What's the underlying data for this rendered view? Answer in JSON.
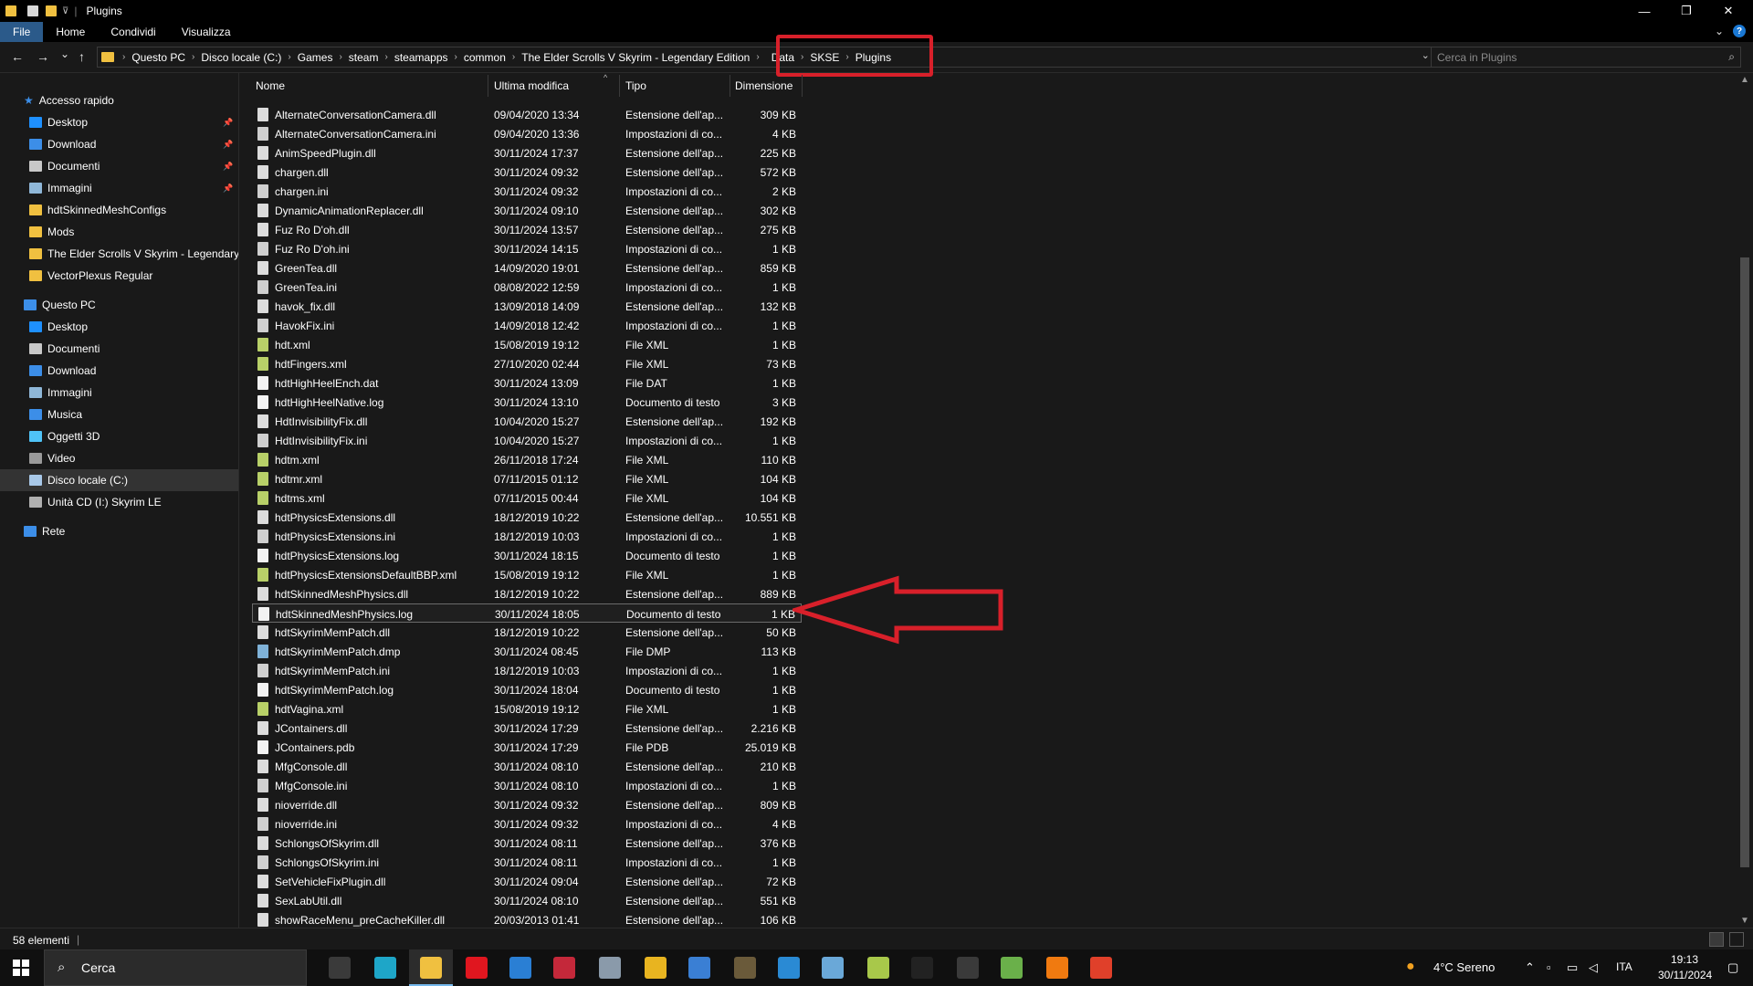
{
  "window": {
    "title": "Plugins",
    "minimize_glyph": "—",
    "maximize_glyph": "❐",
    "close_glyph": "✕"
  },
  "ribbon": {
    "tabs": [
      {
        "label": "File",
        "active": true
      },
      {
        "label": "Home",
        "active": false
      },
      {
        "label": "Condividi",
        "active": false
      },
      {
        "label": "Visualizza",
        "active": false
      }
    ],
    "help": "?"
  },
  "nav": {
    "back": "←",
    "forward": "→",
    "recent": "⌄",
    "up": "↑",
    "breadcrumb": [
      "Questo PC",
      "Disco locale (C:)",
      "Games",
      "steam",
      "steamapps",
      "common",
      "The Elder Scrolls V Skyrim - Legendary Edition",
      "Data",
      "SKSE",
      "Plugins"
    ],
    "dropdown": "⌄",
    "refresh": "↻",
    "search_placeholder": "Cerca in Plugins"
  },
  "sidebar": {
    "quick_access": {
      "label": "Accesso rapido",
      "icon": "star-icon"
    },
    "quick_items": [
      {
        "label": "Desktop",
        "icon": "desktop-icon",
        "pinned": true,
        "color": "#1e90ff"
      },
      {
        "label": "Download",
        "icon": "download-icon",
        "pinned": true,
        "color": "#3c8ee8"
      },
      {
        "label": "Documenti",
        "icon": "document-icon",
        "pinned": true,
        "color": "#c8c8c8"
      },
      {
        "label": "Immagini",
        "icon": "pictures-icon",
        "pinned": true,
        "color": "#8fb7d8"
      },
      {
        "label": "hdtSkinnedMeshConfigs",
        "icon": "folder-icon",
        "pinned": false,
        "color": "#f0c040"
      },
      {
        "label": "Mods",
        "icon": "folder-icon",
        "pinned": false,
        "color": "#f0c040"
      },
      {
        "label": "The Elder Scrolls V Skyrim - Legendary E",
        "icon": "folder-icon",
        "pinned": false,
        "color": "#f0c040"
      },
      {
        "label": "VectorPlexus Regular",
        "icon": "folder-icon",
        "pinned": false,
        "color": "#f0c040"
      }
    ],
    "this_pc": {
      "label": "Questo PC",
      "icon": "computer-icon"
    },
    "pc_items": [
      {
        "label": "Desktop",
        "icon": "desktop-icon",
        "color": "#1e90ff",
        "selected": false
      },
      {
        "label": "Documenti",
        "icon": "document-icon",
        "color": "#c8c8c8",
        "selected": false
      },
      {
        "label": "Download",
        "icon": "download-icon",
        "color": "#3c8ee8",
        "selected": false
      },
      {
        "label": "Immagini",
        "icon": "pictures-icon",
        "color": "#8fb7d8",
        "selected": false
      },
      {
        "label": "Musica",
        "icon": "music-icon",
        "color": "#3c8ee8",
        "selected": false
      },
      {
        "label": "Oggetti 3D",
        "icon": "cube-icon",
        "color": "#4fc3f7",
        "selected": false
      },
      {
        "label": "Video",
        "icon": "video-icon",
        "color": "#9a9a9a",
        "selected": false
      },
      {
        "label": "Disco locale (C:)",
        "icon": "drive-icon",
        "color": "#a8c8e8",
        "selected": true
      },
      {
        "label": "Unità CD (I:) Skyrim LE",
        "icon": "cd-drive-icon",
        "color": "#b0b0b0",
        "selected": false
      }
    ],
    "network": {
      "label": "Rete",
      "icon": "network-icon"
    }
  },
  "columns": {
    "name": "Nome",
    "modified": "Ultima modifica",
    "type": "Tipo",
    "size": "Dimensione",
    "sort_glyph": "^"
  },
  "files": [
    {
      "name": "AlternateConversationCamera.dll",
      "date": "09/04/2020 13:34",
      "type": "Estensione dell'ap...",
      "size": "309 KB",
      "kind": "dll"
    },
    {
      "name": "AlternateConversationCamera.ini",
      "date": "09/04/2020 13:36",
      "type": "Impostazioni di co...",
      "size": "4 KB",
      "kind": "ini"
    },
    {
      "name": "AnimSpeedPlugin.dll",
      "date": "30/11/2024 17:37",
      "type": "Estensione dell'ap...",
      "size": "225 KB",
      "kind": "dll"
    },
    {
      "name": "chargen.dll",
      "date": "30/11/2024 09:32",
      "type": "Estensione dell'ap...",
      "size": "572 KB",
      "kind": "dll"
    },
    {
      "name": "chargen.ini",
      "date": "30/11/2024 09:32",
      "type": "Impostazioni di co...",
      "size": "2 KB",
      "kind": "ini"
    },
    {
      "name": "DynamicAnimationReplacer.dll",
      "date": "30/11/2024 09:10",
      "type": "Estensione dell'ap...",
      "size": "302 KB",
      "kind": "dll"
    },
    {
      "name": "Fuz Ro D'oh.dll",
      "date": "30/11/2024 13:57",
      "type": "Estensione dell'ap...",
      "size": "275 KB",
      "kind": "dll"
    },
    {
      "name": "Fuz Ro D'oh.ini",
      "date": "30/11/2024 14:15",
      "type": "Impostazioni di co...",
      "size": "1 KB",
      "kind": "ini"
    },
    {
      "name": "GreenTea.dll",
      "date": "14/09/2020 19:01",
      "type": "Estensione dell'ap...",
      "size": "859 KB",
      "kind": "dll"
    },
    {
      "name": "GreenTea.ini",
      "date": "08/08/2022 12:59",
      "type": "Impostazioni di co...",
      "size": "1 KB",
      "kind": "ini"
    },
    {
      "name": "havok_fix.dll",
      "date": "13/09/2018 14:09",
      "type": "Estensione dell'ap...",
      "size": "132 KB",
      "kind": "dll"
    },
    {
      "name": "HavokFix.ini",
      "date": "14/09/2018 12:42",
      "type": "Impostazioni di co...",
      "size": "1 KB",
      "kind": "ini"
    },
    {
      "name": "hdt.xml",
      "date": "15/08/2019 19:12",
      "type": "File XML",
      "size": "1 KB",
      "kind": "xml"
    },
    {
      "name": "hdtFingers.xml",
      "date": "27/10/2020 02:44",
      "type": "File XML",
      "size": "73 KB",
      "kind": "xml"
    },
    {
      "name": "hdtHighHeelEnch.dat",
      "date": "30/11/2024 13:09",
      "type": "File DAT",
      "size": "1 KB",
      "kind": "file"
    },
    {
      "name": "hdtHighHeelNative.log",
      "date": "30/11/2024 13:10",
      "type": "Documento di testo",
      "size": "3 KB",
      "kind": "file"
    },
    {
      "name": "HdtInvisibilityFix.dll",
      "date": "10/04/2020 15:27",
      "type": "Estensione dell'ap...",
      "size": "192 KB",
      "kind": "dll"
    },
    {
      "name": "HdtInvisibilityFix.ini",
      "date": "10/04/2020 15:27",
      "type": "Impostazioni di co...",
      "size": "1 KB",
      "kind": "ini"
    },
    {
      "name": "hdtm.xml",
      "date": "26/11/2018 17:24",
      "type": "File XML",
      "size": "110 KB",
      "kind": "xml"
    },
    {
      "name": "hdtmr.xml",
      "date": "07/11/2015 01:12",
      "type": "File XML",
      "size": "104 KB",
      "kind": "xml"
    },
    {
      "name": "hdtms.xml",
      "date": "07/11/2015 00:44",
      "type": "File XML",
      "size": "104 KB",
      "kind": "xml"
    },
    {
      "name": "hdtPhysicsExtensions.dll",
      "date": "18/12/2019 10:22",
      "type": "Estensione dell'ap...",
      "size": "10.551 KB",
      "kind": "dll"
    },
    {
      "name": "hdtPhysicsExtensions.ini",
      "date": "18/12/2019 10:03",
      "type": "Impostazioni di co...",
      "size": "1 KB",
      "kind": "ini"
    },
    {
      "name": "hdtPhysicsExtensions.log",
      "date": "30/11/2024 18:15",
      "type": "Documento di testo",
      "size": "1 KB",
      "kind": "file"
    },
    {
      "name": "hdtPhysicsExtensionsDefaultBBP.xml",
      "date": "15/08/2019 19:12",
      "type": "File XML",
      "size": "1 KB",
      "kind": "xml"
    },
    {
      "name": "hdtSkinnedMeshPhysics.dll",
      "date": "18/12/2019 10:22",
      "type": "Estensione dell'ap...",
      "size": "889 KB",
      "kind": "dll"
    },
    {
      "name": "hdtSkinnedMeshPhysics.log",
      "date": "30/11/2024 18:05",
      "type": "Documento di testo",
      "size": "1 KB",
      "kind": "file",
      "selected": true
    },
    {
      "name": "hdtSkyrimMemPatch.dll",
      "date": "18/12/2019 10:22",
      "type": "Estensione dell'ap...",
      "size": "50 KB",
      "kind": "dll"
    },
    {
      "name": "hdtSkyrimMemPatch.dmp",
      "date": "30/11/2024 08:45",
      "type": "File DMP",
      "size": "113 KB",
      "kind": "dmp"
    },
    {
      "name": "hdtSkyrimMemPatch.ini",
      "date": "18/12/2019 10:03",
      "type": "Impostazioni di co...",
      "size": "1 KB",
      "kind": "ini"
    },
    {
      "name": "hdtSkyrimMemPatch.log",
      "date": "30/11/2024 18:04",
      "type": "Documento di testo",
      "size": "1 KB",
      "kind": "file"
    },
    {
      "name": "hdtVagina.xml",
      "date": "15/08/2019 19:12",
      "type": "File XML",
      "size": "1 KB",
      "kind": "xml"
    },
    {
      "name": "JContainers.dll",
      "date": "30/11/2024 17:29",
      "type": "Estensione dell'ap...",
      "size": "2.216 KB",
      "kind": "dll"
    },
    {
      "name": "JContainers.pdb",
      "date": "30/11/2024 17:29",
      "type": "File PDB",
      "size": "25.019 KB",
      "kind": "file"
    },
    {
      "name": "MfgConsole.dll",
      "date": "30/11/2024 08:10",
      "type": "Estensione dell'ap...",
      "size": "210 KB",
      "kind": "dll"
    },
    {
      "name": "MfgConsole.ini",
      "date": "30/11/2024 08:10",
      "type": "Impostazioni di co...",
      "size": "1 KB",
      "kind": "ini"
    },
    {
      "name": "nioverride.dll",
      "date": "30/11/2024 09:32",
      "type": "Estensione dell'ap...",
      "size": "809 KB",
      "kind": "dll"
    },
    {
      "name": "nioverride.ini",
      "date": "30/11/2024 09:32",
      "type": "Impostazioni di co...",
      "size": "4 KB",
      "kind": "ini"
    },
    {
      "name": "SchlongsOfSkyrim.dll",
      "date": "30/11/2024 08:11",
      "type": "Estensione dell'ap...",
      "size": "376 KB",
      "kind": "dll"
    },
    {
      "name": "SchlongsOfSkyrim.ini",
      "date": "30/11/2024 08:11",
      "type": "Impostazioni di co...",
      "size": "1 KB",
      "kind": "ini"
    },
    {
      "name": "SetVehicleFixPlugin.dll",
      "date": "30/11/2024 09:04",
      "type": "Estensione dell'ap...",
      "size": "72 KB",
      "kind": "dll"
    },
    {
      "name": "SexLabUtil.dll",
      "date": "30/11/2024 08:10",
      "type": "Estensione dell'ap...",
      "size": "551 KB",
      "kind": "dll"
    },
    {
      "name": "showRaceMenu_preCacheKiller.dll",
      "date": "20/03/2013 01:41",
      "type": "Estensione dell'ap...",
      "size": "106 KB",
      "kind": "dll"
    }
  ],
  "status": {
    "count": "58 elementi",
    "separator": "|"
  },
  "taskbar": {
    "search_label": "Cerca",
    "apps": [
      {
        "icon": "task-view-icon",
        "color": "#3a3a3a"
      },
      {
        "icon": "edge-icon",
        "color": "#1ea6c8"
      },
      {
        "icon": "file-explorer-icon",
        "color": "#f0c040",
        "active": true
      },
      {
        "icon": "opera-icon",
        "color": "#e0161f"
      },
      {
        "icon": "store-icon",
        "color": "#2a7fd4"
      },
      {
        "icon": "game-app-icon",
        "color": "#c4283a"
      },
      {
        "icon": "notepad-app-icon",
        "color": "#8a9aaa"
      },
      {
        "icon": "app-yellow-icon",
        "color": "#e8b420"
      },
      {
        "icon": "pen-app-icon",
        "color": "#3a7fd4"
      },
      {
        "icon": "game-launcher-icon",
        "color": "#6a5a3a"
      },
      {
        "icon": "window-app-icon",
        "color": "#2a8ad4"
      },
      {
        "icon": "bird-app-icon",
        "color": "#6aa8d8"
      },
      {
        "icon": "image-app-icon",
        "color": "#a8c84a"
      },
      {
        "icon": "msi-app-icon",
        "color": "#222222"
      },
      {
        "icon": "arrow-app-icon",
        "color": "#3a3a3a"
      },
      {
        "icon": "notepad-plus-icon",
        "color": "#6ab04a"
      },
      {
        "icon": "vlc-icon",
        "color": "#f07a10"
      },
      {
        "icon": "foxit-icon",
        "color": "#e0402a"
      }
    ],
    "weather": "4°C  Sereno",
    "language": "ITA",
    "time": "19:13",
    "date": "30/11/2024"
  },
  "colors": {
    "highlight_red": "#d8202a",
    "background": "#191919",
    "accent_blue": "#1a78d4"
  }
}
